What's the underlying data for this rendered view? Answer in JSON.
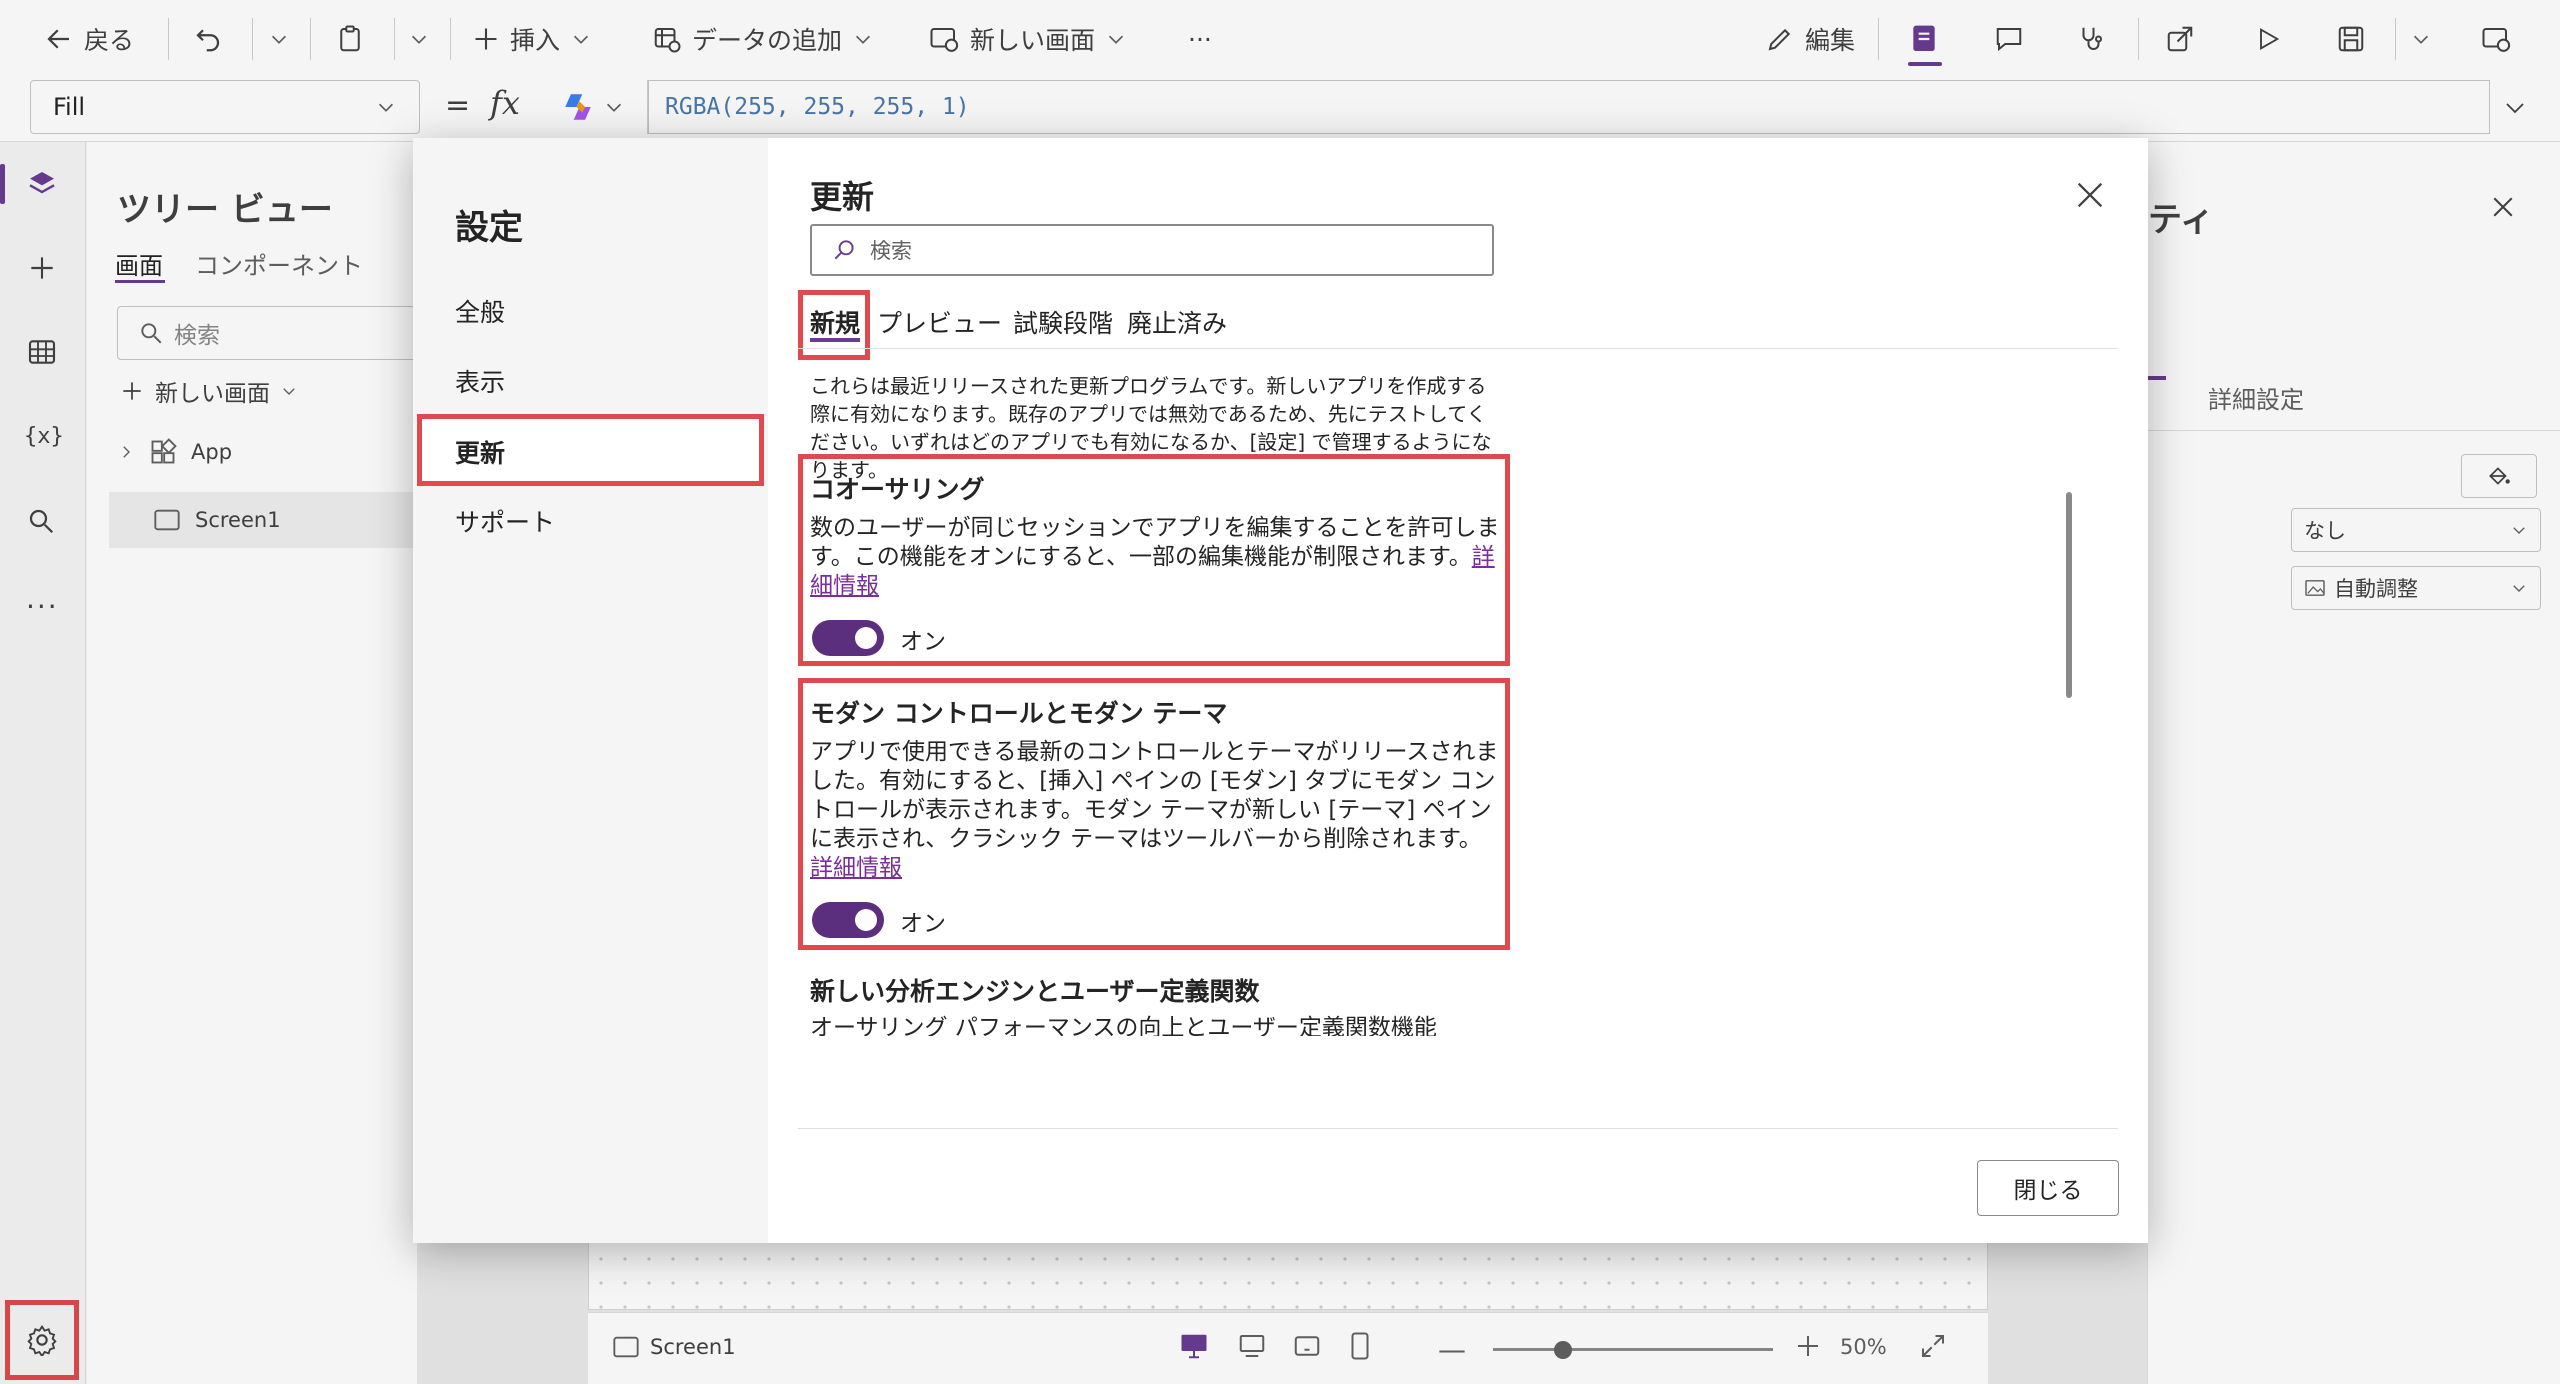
{
  "command_bar": {
    "back": "戻る",
    "insert": "挿入",
    "add_data": "データの追加",
    "new_screen": "新しい画面",
    "more": "···",
    "edit": "編集"
  },
  "formula_bar": {
    "property": "Fill",
    "equals": "=",
    "fx": "fx",
    "formula": "RGBA(255, 255, 255, 1)"
  },
  "tree_view": {
    "title": "ツリー ビュー",
    "tabs": [
      "画面",
      "コンポーネント"
    ],
    "search_placeholder": "検索",
    "new_screen": "新しい画面",
    "items": [
      "App",
      "Screen1"
    ]
  },
  "properties_panel": {
    "title_partial": "ティ",
    "tab_advanced": "詳細設定",
    "dropdown_none": "なし",
    "dropdown_autofit": "自動調整"
  },
  "bottom_bar": {
    "screen": "Screen1",
    "zoom": "50%"
  },
  "dialog": {
    "nav_title": "設定",
    "nav_items": [
      "全般",
      "表示",
      "更新",
      "サポート"
    ],
    "title": "更新",
    "search_placeholder": "検索",
    "tabs": [
      "新規",
      "プレビュー",
      "試験段階",
      "廃止済み"
    ],
    "intro": "これらは最近リリースされた更新プログラムです。新しいアプリを作成する際に有効になります。既存のアプリでは無効であるため、先にテストしてください。いずれはどのアプリでも有効になるか、[設定] で管理するようになります。",
    "features": [
      {
        "title": "コオーサリング",
        "description": "数のユーザーが同じセッションでアプリを編集することを許可します。この機能をオンにすると、一部の編集機能が制限されます。",
        "link": "詳細情報",
        "toggle_label": "オン"
      },
      {
        "title": "モダン コントロールとモダン テーマ",
        "description": "アプリで使用できる最新のコントロールとテーマがリリースされました。有効にすると、[挿入] ペインの [モダン] タブにモダン コントロールが表示されます。モダン テーマが新しい [テーマ] ペインに表示され、クラシック テーマはツールバーから削除されます。",
        "link": "詳細情報",
        "toggle_label": "オン"
      },
      {
        "title": "新しい分析エンジンとユーザー定義関数",
        "description": "オーサリング パフォーマンスの向上とユーザー定義関数機能"
      }
    ],
    "close_button": "閉じる"
  },
  "colors": {
    "accent": "#5c2e7e",
    "highlight": "#e0494d"
  }
}
